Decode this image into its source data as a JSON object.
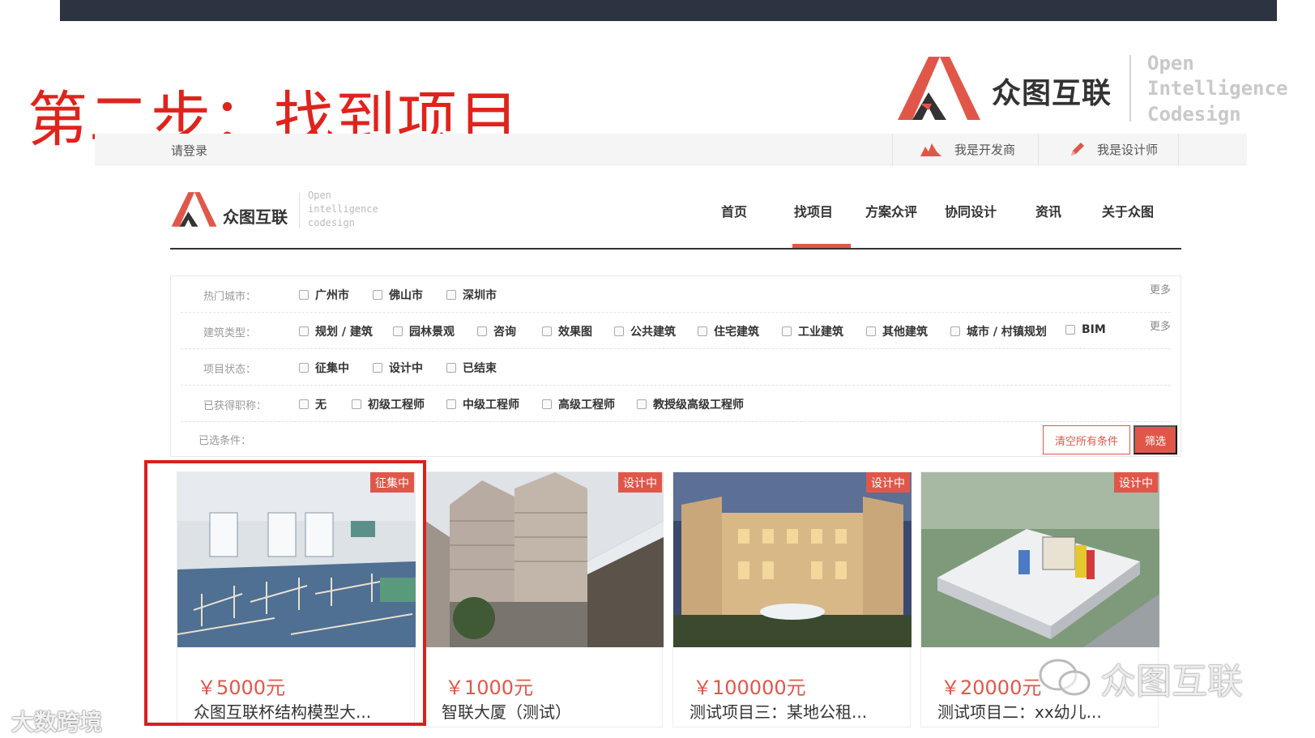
{
  "slide": {
    "title": "第二步：找到项目",
    "accent_color": "#e0231c",
    "topbar_color": "#2d3441"
  },
  "brand": {
    "name": "众图互联",
    "tagline": [
      "Open",
      "Intelligence",
      "Codesign"
    ],
    "nav_tagline": [
      "Open",
      "intelligence",
      "codesign"
    ],
    "logo_icon": "zhongtu-logo-icon"
  },
  "loginbar": {
    "login": "请登录",
    "developer": "我是开发商",
    "designer": "我是设计师",
    "developer_icon": "buildings-icon",
    "designer_icon": "pencil-icon"
  },
  "nav": {
    "items": [
      "首页",
      "找项目",
      "方案众评",
      "协同设计",
      "资讯",
      "关于众图"
    ],
    "active": "找项目"
  },
  "filters": {
    "rows": [
      {
        "label": "热门城市：",
        "options": [
          "广州市",
          "佛山市",
          "深圳市"
        ],
        "more": "更多"
      },
      {
        "label": "建筑类型：",
        "options": [
          "规划 / 建筑",
          "园林景观",
          "咨询",
          "效果图",
          "公共建筑",
          "住宅建筑",
          "工业建筑",
          "其他建筑",
          "城市 / 村镇规划",
          "BIM"
        ],
        "more": "更多"
      },
      {
        "label": "项目状态：",
        "options": [
          "征集中",
          "设计中",
          "已结束"
        ]
      },
      {
        "label": "已获得职称：",
        "options": [
          "无",
          "初级工程师",
          "中级工程师",
          "高级工程师",
          "教授级高级工程师"
        ]
      }
    ],
    "selected_label": "已选条件：",
    "clear_label": "清空所有条件",
    "filter_label": "筛选"
  },
  "projects": [
    {
      "status": "征集中",
      "price": "￥5000元",
      "name": "众图互联杯结构模型大...",
      "image": "classroom-photo"
    },
    {
      "status": "设计中",
      "price": "￥1000元",
      "name": "智联大厦（测试）",
      "image": "highrise-photo"
    },
    {
      "status": "设计中",
      "price": "￥100000元",
      "name": "测试项目三：某地公租...",
      "image": "villa-photo"
    },
    {
      "status": "设计中",
      "price": "￥20000元",
      "name": "测试项目二：xx幼儿...",
      "image": "kindergarten-photo"
    }
  ],
  "watermarks": {
    "left": "大数跨境",
    "right": "众图互联"
  }
}
